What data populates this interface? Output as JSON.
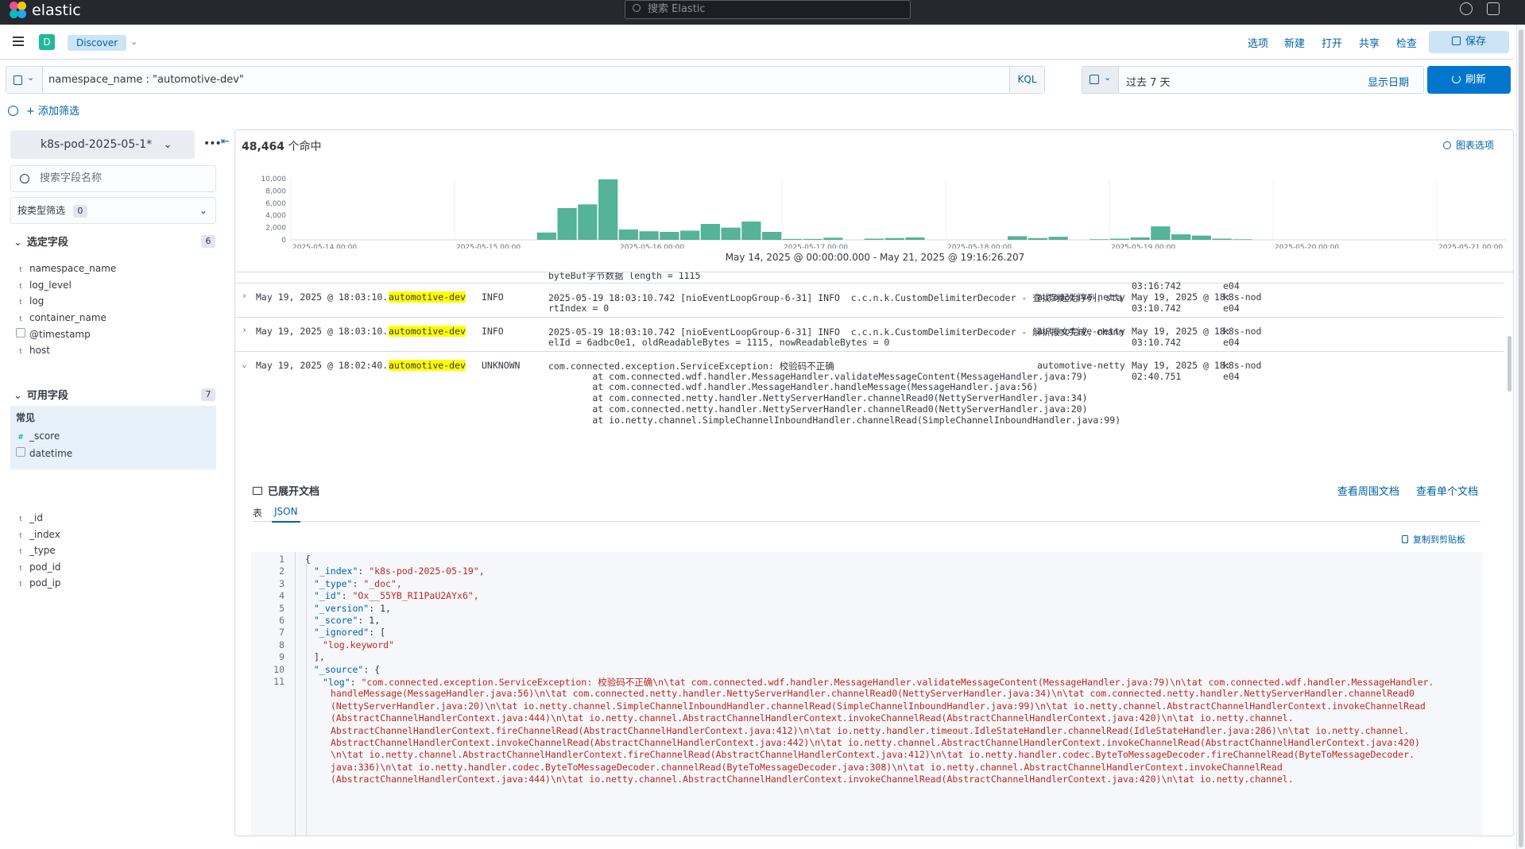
{
  "header": {
    "logo_text": "elastic",
    "search_placeholder": "搜索 Elastic"
  },
  "appbar": {
    "space_letter": "D",
    "breadcrumb": "Discover",
    "links": [
      "选项",
      "新建",
      "打开",
      "共享",
      "检查"
    ],
    "save_label": "保存"
  },
  "query": {
    "text": "namespace_name : \"automotive-dev\"",
    "language": "KQL",
    "date_range": "过去 7 天",
    "show_dates": "显示日期",
    "refresh_label": "刷新",
    "add_filter": "+ 添加筛选"
  },
  "sidebar": {
    "index_pattern": "k8s-pod-2025-05-1*",
    "field_search_placeholder": "搜索字段名称",
    "type_filter_label": "按类型筛选",
    "type_filter_count": "0",
    "selected_header": "选定字段",
    "selected_count": "6",
    "selected_fields": [
      {
        "type": "t",
        "name": "namespace_name"
      },
      {
        "type": "t",
        "name": "log_level"
      },
      {
        "type": "t",
        "name": "log"
      },
      {
        "type": "t",
        "name": "container_name"
      },
      {
        "type": "date",
        "name": "@timestamp"
      },
      {
        "type": "t",
        "name": "host"
      }
    ],
    "available_header": "可用字段",
    "available_count": "7",
    "popular_header": "常见",
    "popular_fields": [
      {
        "type": "#",
        "name": "_score"
      },
      {
        "type": "date",
        "name": "datetime"
      }
    ],
    "other_fields": [
      {
        "type": "t",
        "name": "_id"
      },
      {
        "type": "t",
        "name": "_index"
      },
      {
        "type": "t",
        "name": "_type"
      },
      {
        "type": "t",
        "name": "pod_id"
      },
      {
        "type": "t",
        "name": "pod_ip"
      }
    ]
  },
  "main": {
    "hits_count": "48,464",
    "hits_suffix": "个命中",
    "chart_options": "图表选项",
    "range_label": "May 14, 2025 @ 00:00:00.000 - May 21, 2025 @ 19:16:26.207"
  },
  "chart_data": {
    "type": "bar",
    "title": "",
    "ylim": [
      0,
      10000
    ],
    "yticks": [
      "10,000",
      "8,000",
      "6,000",
      "4,000",
      "2,000",
      "0"
    ],
    "xticks": [
      "2025-05-14 00:00",
      "2025-05-15 00:00",
      "2025-05-16 00:00",
      "2025-05-17 00:00",
      "2025-05-18 00:00",
      "2025-05-19 00:00",
      "2025-05-20 00:00",
      "2025-05-21 00:00"
    ],
    "bar_width_days": 0.125,
    "bars": [
      {
        "day": 1.5,
        "value": 1200
      },
      {
        "day": 1.625,
        "value": 5200
      },
      {
        "day": 1.75,
        "value": 5800
      },
      {
        "day": 1.875,
        "value": 9900
      },
      {
        "day": 2.0,
        "value": 1700
      },
      {
        "day": 2.125,
        "value": 1400
      },
      {
        "day": 2.25,
        "value": 1300
      },
      {
        "day": 2.375,
        "value": 1500
      },
      {
        "day": 2.5,
        "value": 2600
      },
      {
        "day": 2.625,
        "value": 2000
      },
      {
        "day": 2.75,
        "value": 3000
      },
      {
        "day": 2.875,
        "value": 1300
      },
      {
        "day": 3.0,
        "value": 150
      },
      {
        "day": 3.125,
        "value": 150
      },
      {
        "day": 3.25,
        "value": 350
      },
      {
        "day": 3.5,
        "value": 200
      },
      {
        "day": 3.625,
        "value": 300
      },
      {
        "day": 3.75,
        "value": 400
      },
      {
        "day": 4.375,
        "value": 600
      },
      {
        "day": 4.5,
        "value": 300
      },
      {
        "day": 4.625,
        "value": 500
      },
      {
        "day": 4.875,
        "value": 100
      },
      {
        "day": 5.0,
        "value": 200
      },
      {
        "day": 5.125,
        "value": 400
      },
      {
        "day": 5.25,
        "value": 2200
      },
      {
        "day": 5.375,
        "value": 900
      },
      {
        "day": 5.5,
        "value": 700
      },
      {
        "day": 5.625,
        "value": 200
      },
      {
        "day": 5.75,
        "value": 100
      }
    ],
    "current_time_marker_day": 7.8,
    "bar_color": "#54b399",
    "marker_color": "#bd271e"
  },
  "docs": [
    {
      "time": "",
      "namespace": "",
      "level": "",
      "log": [
        "byteBuf字节数据 length = 1115"
      ],
      "container": "",
      "timestamp": [
        "",
        "03:16:742"
      ],
      "host": [
        "",
        "e04"
      ],
      "partial": true
    },
    {
      "time": "May 19, 2025 @ 18:03:10.742",
      "namespace": "automotive-dev",
      "level": "INFO",
      "log": [
        "2025-05-19 18:03:10.742 [nioEventLoopGroup-6-31] INFO  c.c.n.k.CustomDelimiterDecoder - 查找到起始序列，sta",
        "rtIndex = 0"
      ],
      "container": "automotive-netty",
      "timestamp": [
        "May 19, 2025 @ 18:",
        "03:10.742"
      ],
      "host": [
        "k8s-nod",
        "e04"
      ]
    },
    {
      "time": "May 19, 2025 @ 18:03:10.742",
      "namespace": "automotive-dev",
      "level": "INFO",
      "log": [
        "2025-05-19 18:03:10.742 [nioEventLoopGroup-6-31] INFO  c.c.n.k.CustomDelimiterDecoder - 解析报文完成，chann",
        "elId = 6adbc0e1, oldReadableBytes = 1115, nowReadableBytes = 0"
      ],
      "container": "automotive-netty",
      "timestamp": [
        "May 19, 2025 @ 18:",
        "03:10.742"
      ],
      "host": [
        "k8s-nod",
        "e04"
      ]
    },
    {
      "time": "May 19, 2025 @ 18:02:40.751",
      "namespace": "automotive-dev",
      "level": "UNKNOWN",
      "log": [
        "com.connected.exception.ServiceException: 校验码不正确",
        "        at com.connected.wdf.handler.MessageHandler.validateMessageContent(MessageHandler.java:79)",
        "        at com.connected.wdf.handler.MessageHandler.handleMessage(MessageHandler.java:56)",
        "        at com.connected.netty.handler.NettyServerHandler.channelRead0(NettyServerHandler.java:34)",
        "        at com.connected.netty.handler.NettyServerHandler.channelRead0(NettyServerHandler.java:20)",
        "        at io.netty.channel.SimpleChannelInboundHandler.channelRead(SimpleChannelInboundHandler.java:99)"
      ],
      "container": "automotive-netty",
      "timestamp": [
        "May 19, 2025 @ 18:",
        "02:40.751"
      ],
      "host": [
        "k8s-nod",
        "e04"
      ]
    }
  ],
  "expanded": {
    "title": "已展开文档",
    "view_surrounding": "查看周围文档",
    "view_single": "查看单个文档",
    "tab_table": "表",
    "tab_json": "JSON",
    "copy": "复制到剪贴板",
    "json_lines": [
      {
        "n": "1",
        "indent": 0,
        "key": "",
        "val": "{",
        "kind": "plain"
      },
      {
        "n": "2",
        "indent": 1,
        "key": "\"_index\"",
        "val": "\"k8s-pod-2025-05-19\",",
        "kind": "kv"
      },
      {
        "n": "3",
        "indent": 1,
        "key": "\"_type\"",
        "val": "\"_doc\",",
        "kind": "kv"
      },
      {
        "n": "4",
        "indent": 1,
        "key": "\"_id\"",
        "val": "\"Ox__55YB_RI1PaU2AYx6\",",
        "kind": "kv"
      },
      {
        "n": "5",
        "indent": 1,
        "key": "\"_version\"",
        "val": "1,",
        "kind": "kv"
      },
      {
        "n": "6",
        "indent": 1,
        "key": "\"_score\"",
        "val": "1,",
        "kind": "kv"
      },
      {
        "n": "7",
        "indent": 1,
        "key": "\"_ignored\"",
        "val": "[",
        "kind": "kvplain"
      },
      {
        "n": "8",
        "indent": 2,
        "key": "",
        "val": "\"log.keyword\"",
        "kind": "str"
      },
      {
        "n": "9",
        "indent": 1,
        "key": "",
        "val": "],",
        "kind": "plain"
      },
      {
        "n": "10",
        "indent": 1,
        "key": "\"_source\"",
        "val": "{",
        "kind": "kvplain"
      },
      {
        "n": "11",
        "indent": 2,
        "key": "\"log\"",
        "val": "\"com.connected.exception.ServiceException: 校验码不正确\\n\\tat com.connected.wdf.handler.MessageHandler.validateMessageContent(MessageHandler.java:79)\\n\\tat com.connected.wdf.handler.MessageHandler.",
        "kind": "kv"
      }
    ],
    "log_continuation": [
      "handleMessage(MessageHandler.java:56)\\n\\tat com.connected.netty.handler.NettyServerHandler.channelRead0(NettyServerHandler.java:34)\\n\\tat com.connected.netty.handler.NettyServerHandler.channelRead0",
      "(NettyServerHandler.java:20)\\n\\tat io.netty.channel.SimpleChannelInboundHandler.channelRead(SimpleChannelInboundHandler.java:99)\\n\\tat io.netty.channel.AbstractChannelHandlerContext.invokeChannelRead",
      "(AbstractChannelHandlerContext.java:444)\\n\\tat io.netty.channel.AbstractChannelHandlerContext.invokeChannelRead(AbstractChannelHandlerContext.java:420)\\n\\tat io.netty.channel.",
      "AbstractChannelHandlerContext.fireChannelRead(AbstractChannelHandlerContext.java:412)\\n\\tat io.netty.handler.timeout.IdleStateHandler.channelRead(IdleStateHandler.java:286)\\n\\tat io.netty.channel.",
      "AbstractChannelHandlerContext.invokeChannelRead(AbstractChannelHandlerContext.java:442)\\n\\tat io.netty.channel.AbstractChannelHandlerContext.invokeChannelRead(AbstractChannelHandlerContext.java:420)",
      "\\n\\tat io.netty.channel.AbstractChannelHandlerContext.fireChannelRead(AbstractChannelHandlerContext.java:412)\\n\\tat io.netty.handler.codec.ByteToMessageDecoder.fireChannelRead(ByteToMessageDecoder.",
      "java:336)\\n\\tat io.netty.handler.codec.ByteToMessageDecoder.channelRead(ByteToMessageDecoder.java:308)\\n\\tat io.netty.channel.AbstractChannelHandlerContext.invokeChannelRead",
      "(AbstractChannelHandlerContext.java:444)\\n\\tat io.netty.channel.AbstractChannelHandlerContext.invokeChannelRead(AbstractChannelHandlerContext.java:420)\\n\\tat io.netty.channel."
    ]
  },
  "colors": {
    "accent": "#0077cc",
    "link": "#0061a6",
    "highlight": "#ffff00",
    "topbar": "#25282f"
  }
}
